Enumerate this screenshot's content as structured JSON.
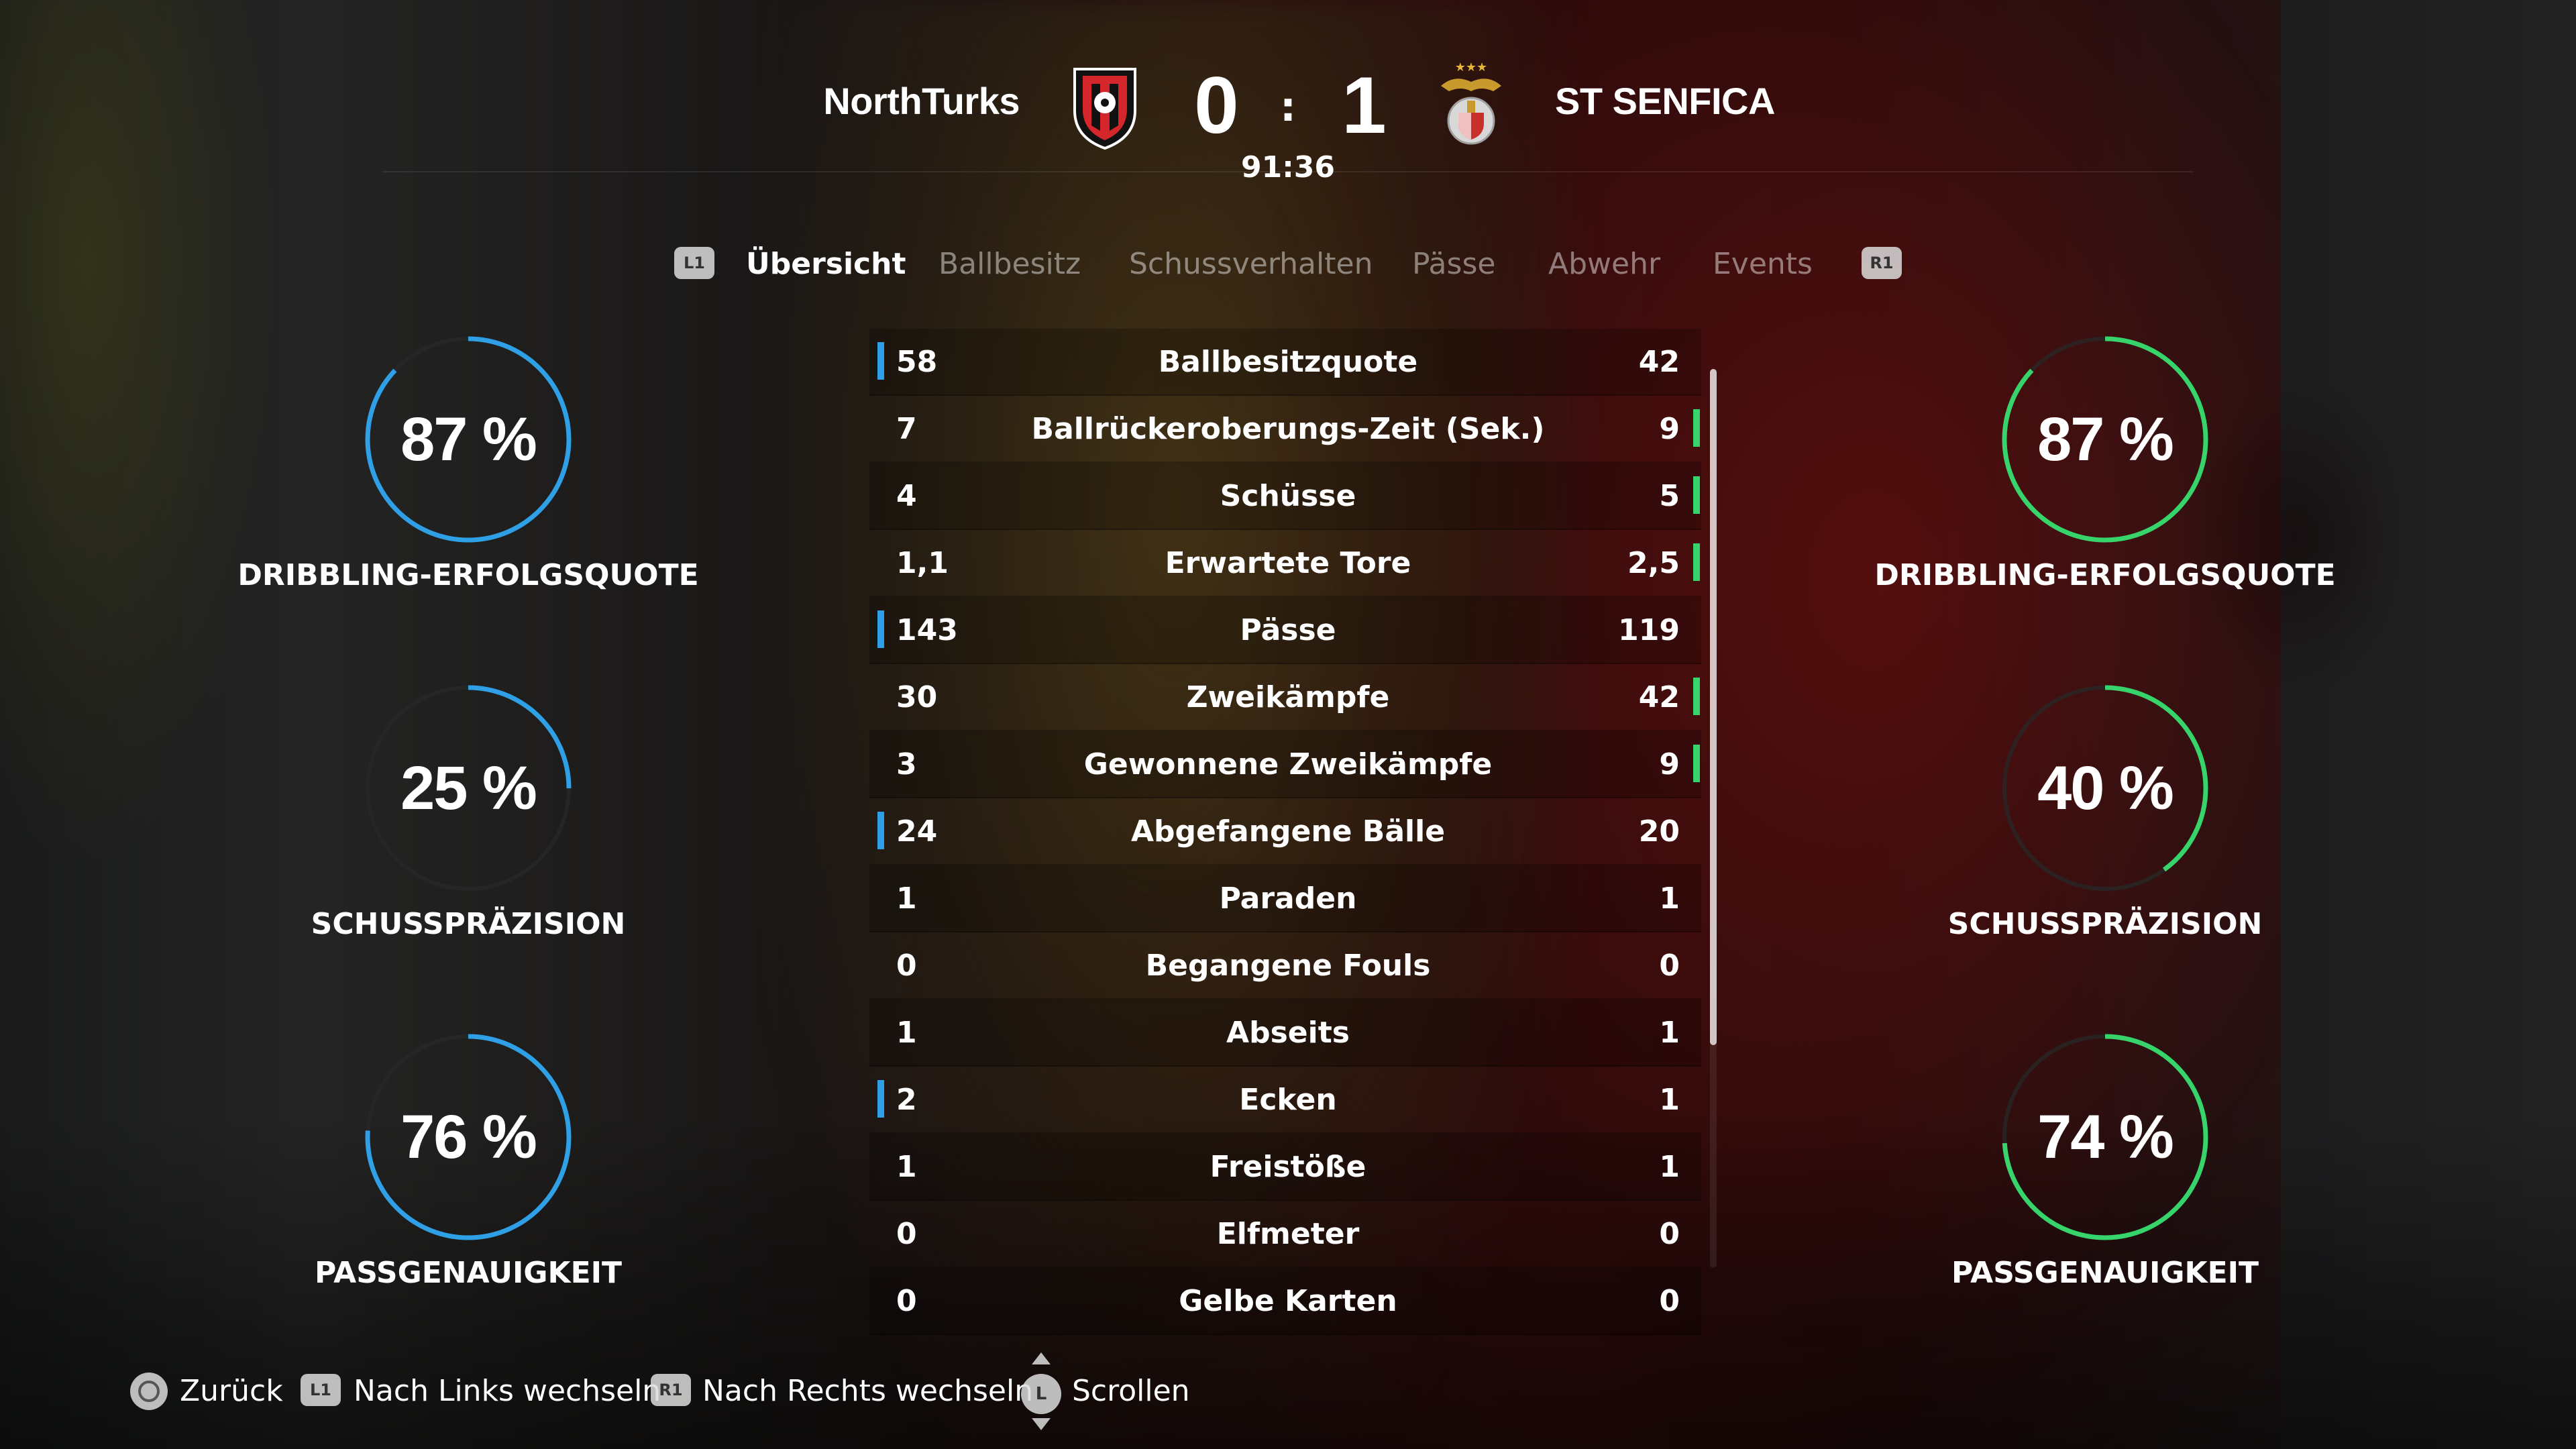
{
  "match": {
    "home_team": "NorthTurks",
    "away_team": "ST SENFICA",
    "home_score": "0",
    "separator": ":",
    "away_score": "1",
    "clock": "91:36"
  },
  "tabs": {
    "left_badge": "L1",
    "right_badge": "R1",
    "items": [
      {
        "label": "Übersicht",
        "active": true
      },
      {
        "label": "Ballbesitz",
        "active": false
      },
      {
        "label": "Schussverhalten",
        "active": false
      },
      {
        "label": "Pässe",
        "active": false
      },
      {
        "label": "Abwehr",
        "active": false
      },
      {
        "label": "Events",
        "active": false
      }
    ]
  },
  "home_rings": [
    {
      "value": "87 %",
      "pct": 87,
      "label": "DRIBBLING-ERFOLGSQUOTE"
    },
    {
      "value": "25 %",
      "pct": 25,
      "label": "SCHUSSPRÄZISION"
    },
    {
      "value": "76 %",
      "pct": 76,
      "label": "PASSGENAUIGKEIT"
    }
  ],
  "away_rings": [
    {
      "value": "87 %",
      "pct": 87,
      "label": "DRIBBLING-ERFOLGSQUOTE"
    },
    {
      "value": "40 %",
      "pct": 40,
      "label": "SCHUSSPRÄZISION"
    },
    {
      "value": "74 %",
      "pct": 74,
      "label": "PASSGENAUIGKEIT"
    }
  ],
  "colors": {
    "home": "#2f9fe6",
    "away": "#36d46a"
  },
  "stats": [
    {
      "home": "58",
      "label": "Ballbesitzquote",
      "away": "42",
      "lead": "home"
    },
    {
      "home": "7",
      "label": "Ballrückeroberungs-Zeit (Sek.)",
      "away": "9",
      "lead": "away"
    },
    {
      "home": "4",
      "label": "Schüsse",
      "away": "5",
      "lead": "away"
    },
    {
      "home": "1,1",
      "label": "Erwartete Tore",
      "away": "2,5",
      "lead": "away"
    },
    {
      "home": "143",
      "label": "Pässe",
      "away": "119",
      "lead": "home"
    },
    {
      "home": "30",
      "label": "Zweikämpfe",
      "away": "42",
      "lead": "away"
    },
    {
      "home": "3",
      "label": "Gewonnene Zweikämpfe",
      "away": "9",
      "lead": "away"
    },
    {
      "home": "24",
      "label": "Abgefangene Bälle",
      "away": "20",
      "lead": "home"
    },
    {
      "home": "1",
      "label": "Paraden",
      "away": "1",
      "lead": "none"
    },
    {
      "home": "0",
      "label": "Begangene Fouls",
      "away": "0",
      "lead": "none"
    },
    {
      "home": "1",
      "label": "Abseits",
      "away": "1",
      "lead": "none"
    },
    {
      "home": "2",
      "label": "Ecken",
      "away": "1",
      "lead": "home"
    },
    {
      "home": "1",
      "label": "Freistöße",
      "away": "1",
      "lead": "none"
    },
    {
      "home": "0",
      "label": "Elfmeter",
      "away": "0",
      "lead": "none"
    },
    {
      "home": "0",
      "label": "Gelbe Karten",
      "away": "0",
      "lead": "none"
    }
  ],
  "footer": {
    "back_label": "Zurück",
    "l1_badge": "L1",
    "left_label": "Nach Links wechseln",
    "r1_badge": "R1",
    "right_label": "Nach Rechts wechseln",
    "stick_badge": "L",
    "scroll_label": "Scrollen"
  }
}
